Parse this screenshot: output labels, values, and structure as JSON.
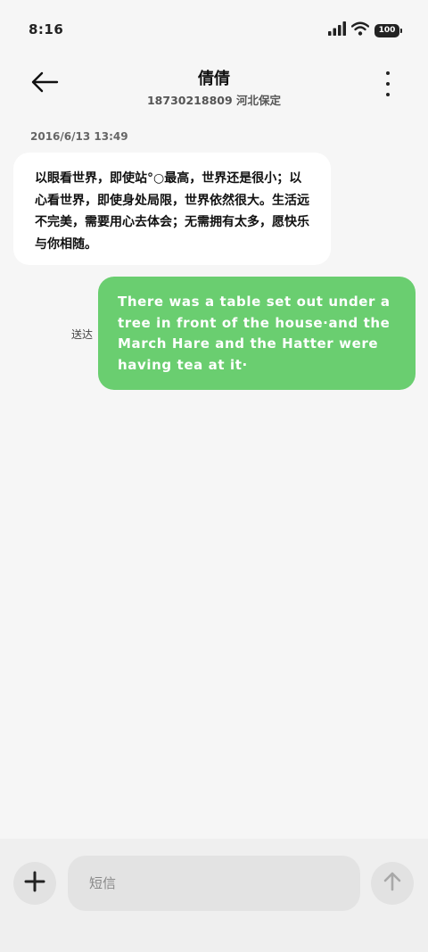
{
  "status_bar": {
    "time": "8:16",
    "battery": "100",
    "icons": [
      "signal-icon",
      "wifi-icon",
      "battery-icon"
    ]
  },
  "header": {
    "title": "倩倩",
    "subtitle": "18730218809   河北保定",
    "back_icon": "back-arrow-icon",
    "more_icon": "more-vertical-icon"
  },
  "conversation": {
    "timestamp": "2016/6/13  13:49",
    "incoming_message": "以眼看世界，即使站°○最高，世界还是很小；以心看世界，即使身处局限，世界依然很大。生活远不完美，需要用心去体会；无需拥有太多，愿快乐与你相随。",
    "outgoing_message": "There was a table set out under a tree in front of the house·and the March Hare and the Hatter were having tea at it·",
    "delivery_status": "送达"
  },
  "composer": {
    "placeholder": "短信",
    "add_icon": "plus-icon",
    "send_icon": "send-arrow-up-icon"
  },
  "colors": {
    "background": "#f6f6f6",
    "outgoing_bubble": "#6ace70",
    "incoming_bubble": "#ffffff",
    "composer_bg": "#efefef"
  }
}
